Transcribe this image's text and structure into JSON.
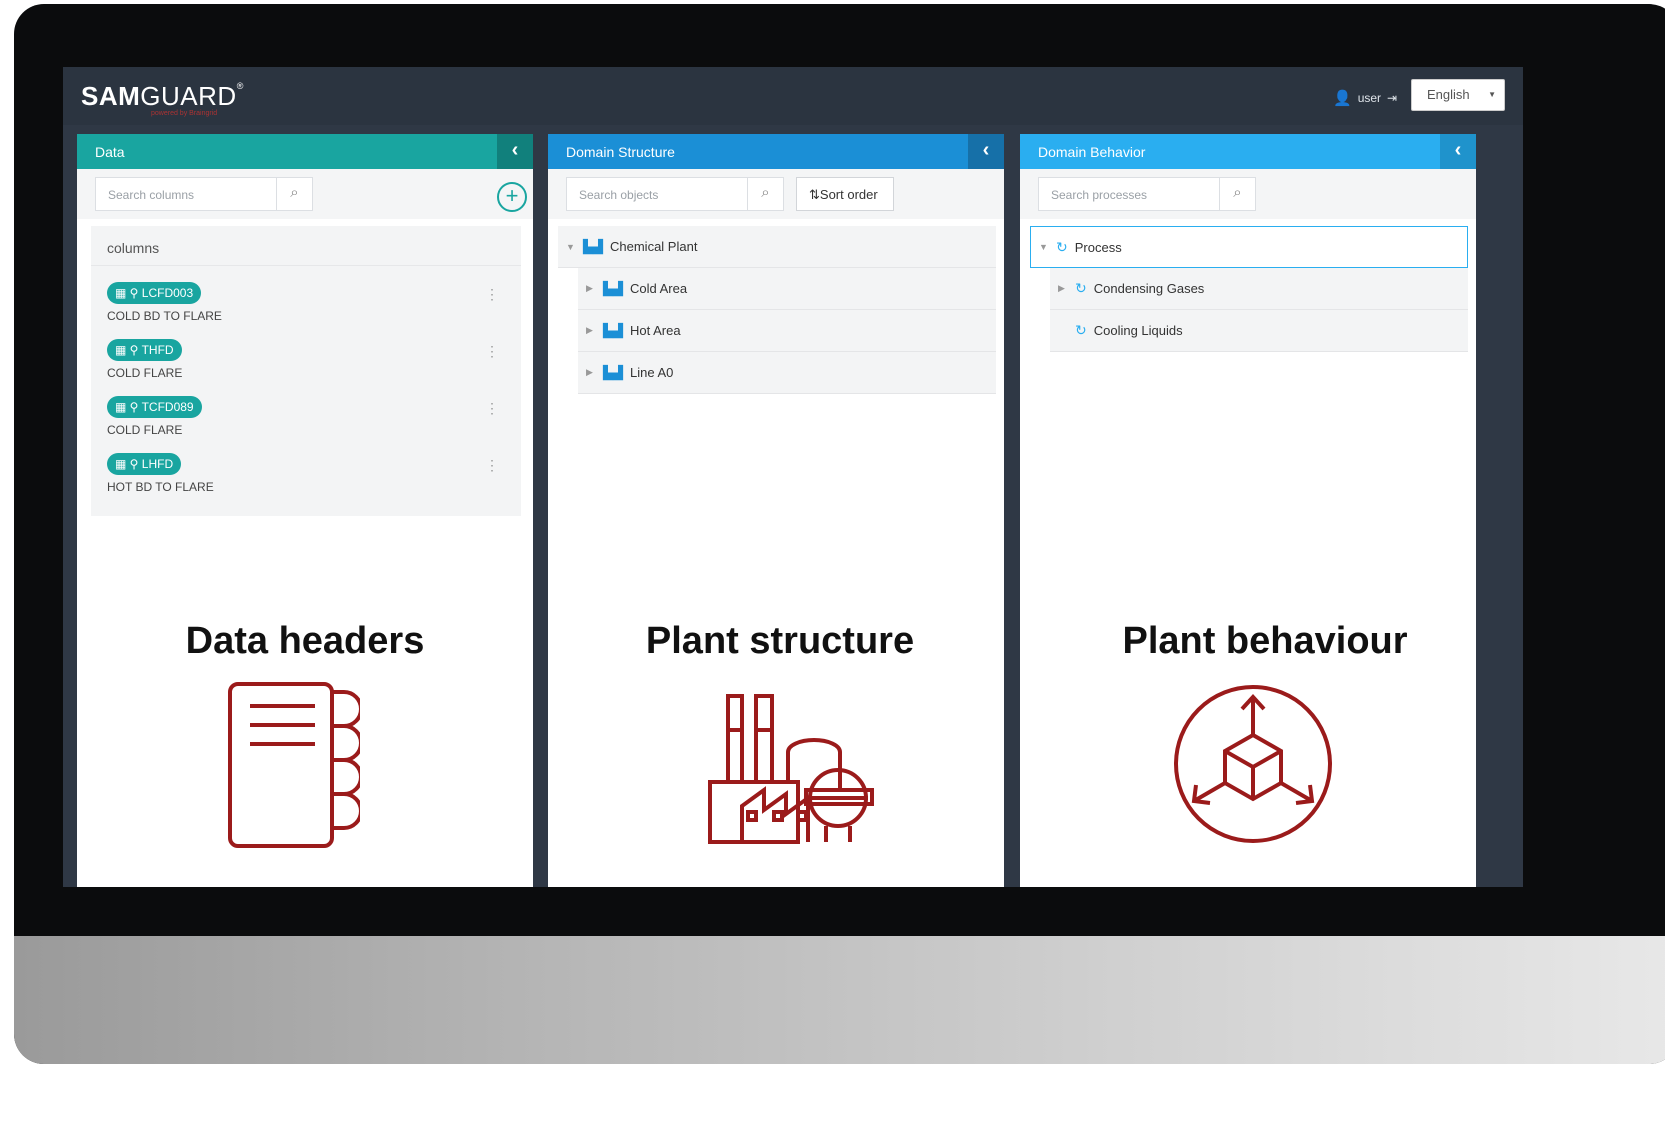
{
  "brand": {
    "name_bold": "SAM",
    "name_light": "GUARD",
    "trademark": "®",
    "tagline": "powered by Braingrid"
  },
  "topbar": {
    "user": "user",
    "language": "English"
  },
  "panels": {
    "data": {
      "title": "Data",
      "search_placeholder": "Search columns",
      "list_title": "columns",
      "items": [
        {
          "tag": "LCFD003",
          "desc": "COLD BD TO FLARE"
        },
        {
          "tag": "THFD",
          "desc": "COLD FLARE"
        },
        {
          "tag": "TCFD089",
          "desc": "COLD FLARE"
        },
        {
          "tag": "LHFD",
          "desc": "HOT BD TO FLARE"
        }
      ]
    },
    "structure": {
      "title": "Domain Structure",
      "search_placeholder": "Search objects",
      "sort_label": "Sort order",
      "root": "Chemical Plant",
      "children": [
        "Cold Area",
        "Hot Area",
        "Line A0"
      ]
    },
    "behavior": {
      "title": "Domain Behavior",
      "search_placeholder": "Search processes",
      "root": "Process",
      "children": [
        "Condensing Gases",
        "Cooling Liquids"
      ]
    }
  },
  "captions": {
    "data": "Data headers",
    "structure": "Plant structure",
    "behavior": "Plant behaviour"
  },
  "colors": {
    "teal": "#19a5a0",
    "blue": "#1b8fd6",
    "light_blue": "#2aaef0",
    "icon_red": "#9b1b1b"
  }
}
